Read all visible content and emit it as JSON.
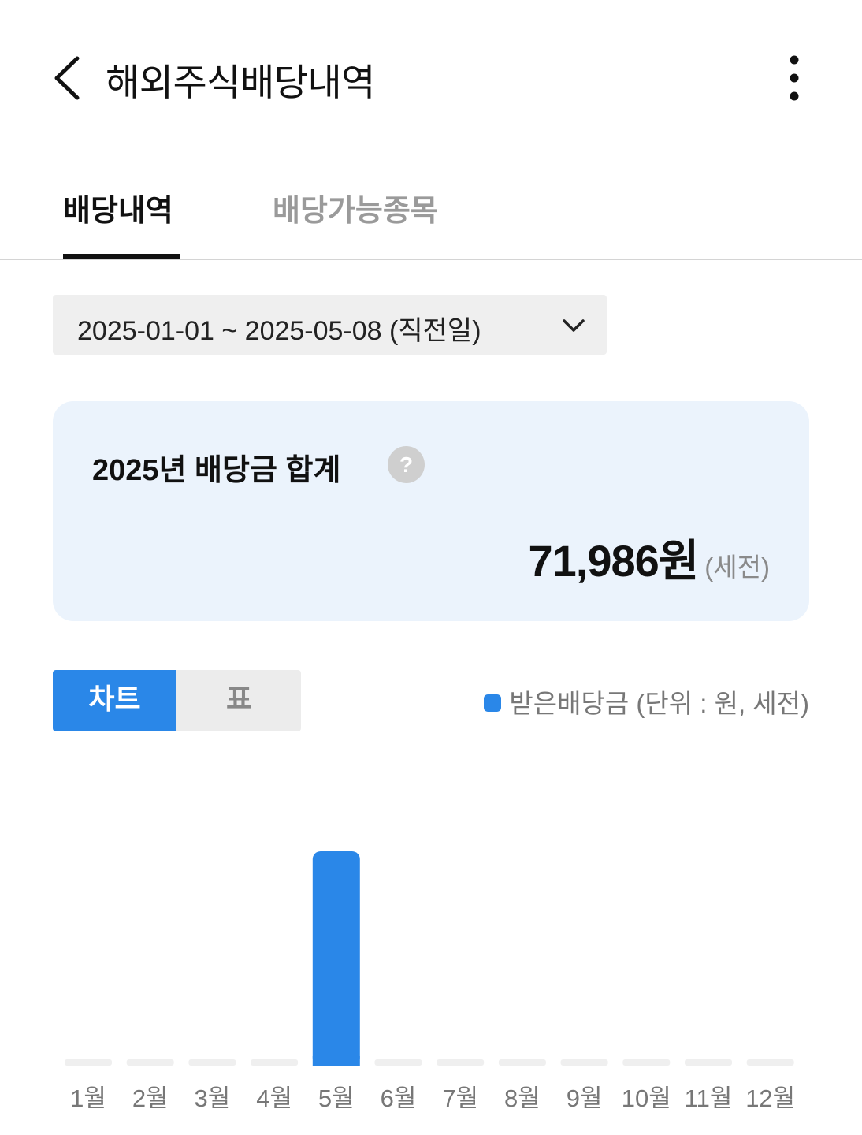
{
  "header": {
    "title": "해외주식배당내역",
    "back_icon": "chevron-left-icon",
    "more_icon": "more-vertical-icon"
  },
  "tabs": [
    {
      "label": "배당내역",
      "active": true
    },
    {
      "label": "배당가능종목",
      "active": false
    }
  ],
  "date_range": {
    "value": "2025-01-01 ~ 2025-05-08 (직전일)",
    "icon": "chevron-down-icon"
  },
  "summary": {
    "title": "2025년 배당금 합계",
    "help_label": "?",
    "amount": "71,986원",
    "amount_note": "(세전)"
  },
  "view_toggle": {
    "options": [
      "차트",
      "표"
    ],
    "selected": "차트"
  },
  "legend": {
    "label": "받은배당금 (단위 : 원, 세전)",
    "color": "#2a87e8"
  },
  "colors": {
    "accent": "#2a87e8",
    "empty_bar": "#efefef"
  },
  "chart_data": {
    "type": "bar",
    "categories": [
      "1월",
      "2월",
      "3월",
      "4월",
      "5월",
      "6월",
      "7월",
      "8월",
      "9월",
      "10월",
      "11월",
      "12월"
    ],
    "series": [
      {
        "values": [
          0,
          0,
          0,
          0,
          71986,
          0,
          0,
          0,
          0,
          0,
          0,
          0
        ]
      }
    ],
    "ylim": [
      0,
      71986
    ],
    "grid": false
  }
}
